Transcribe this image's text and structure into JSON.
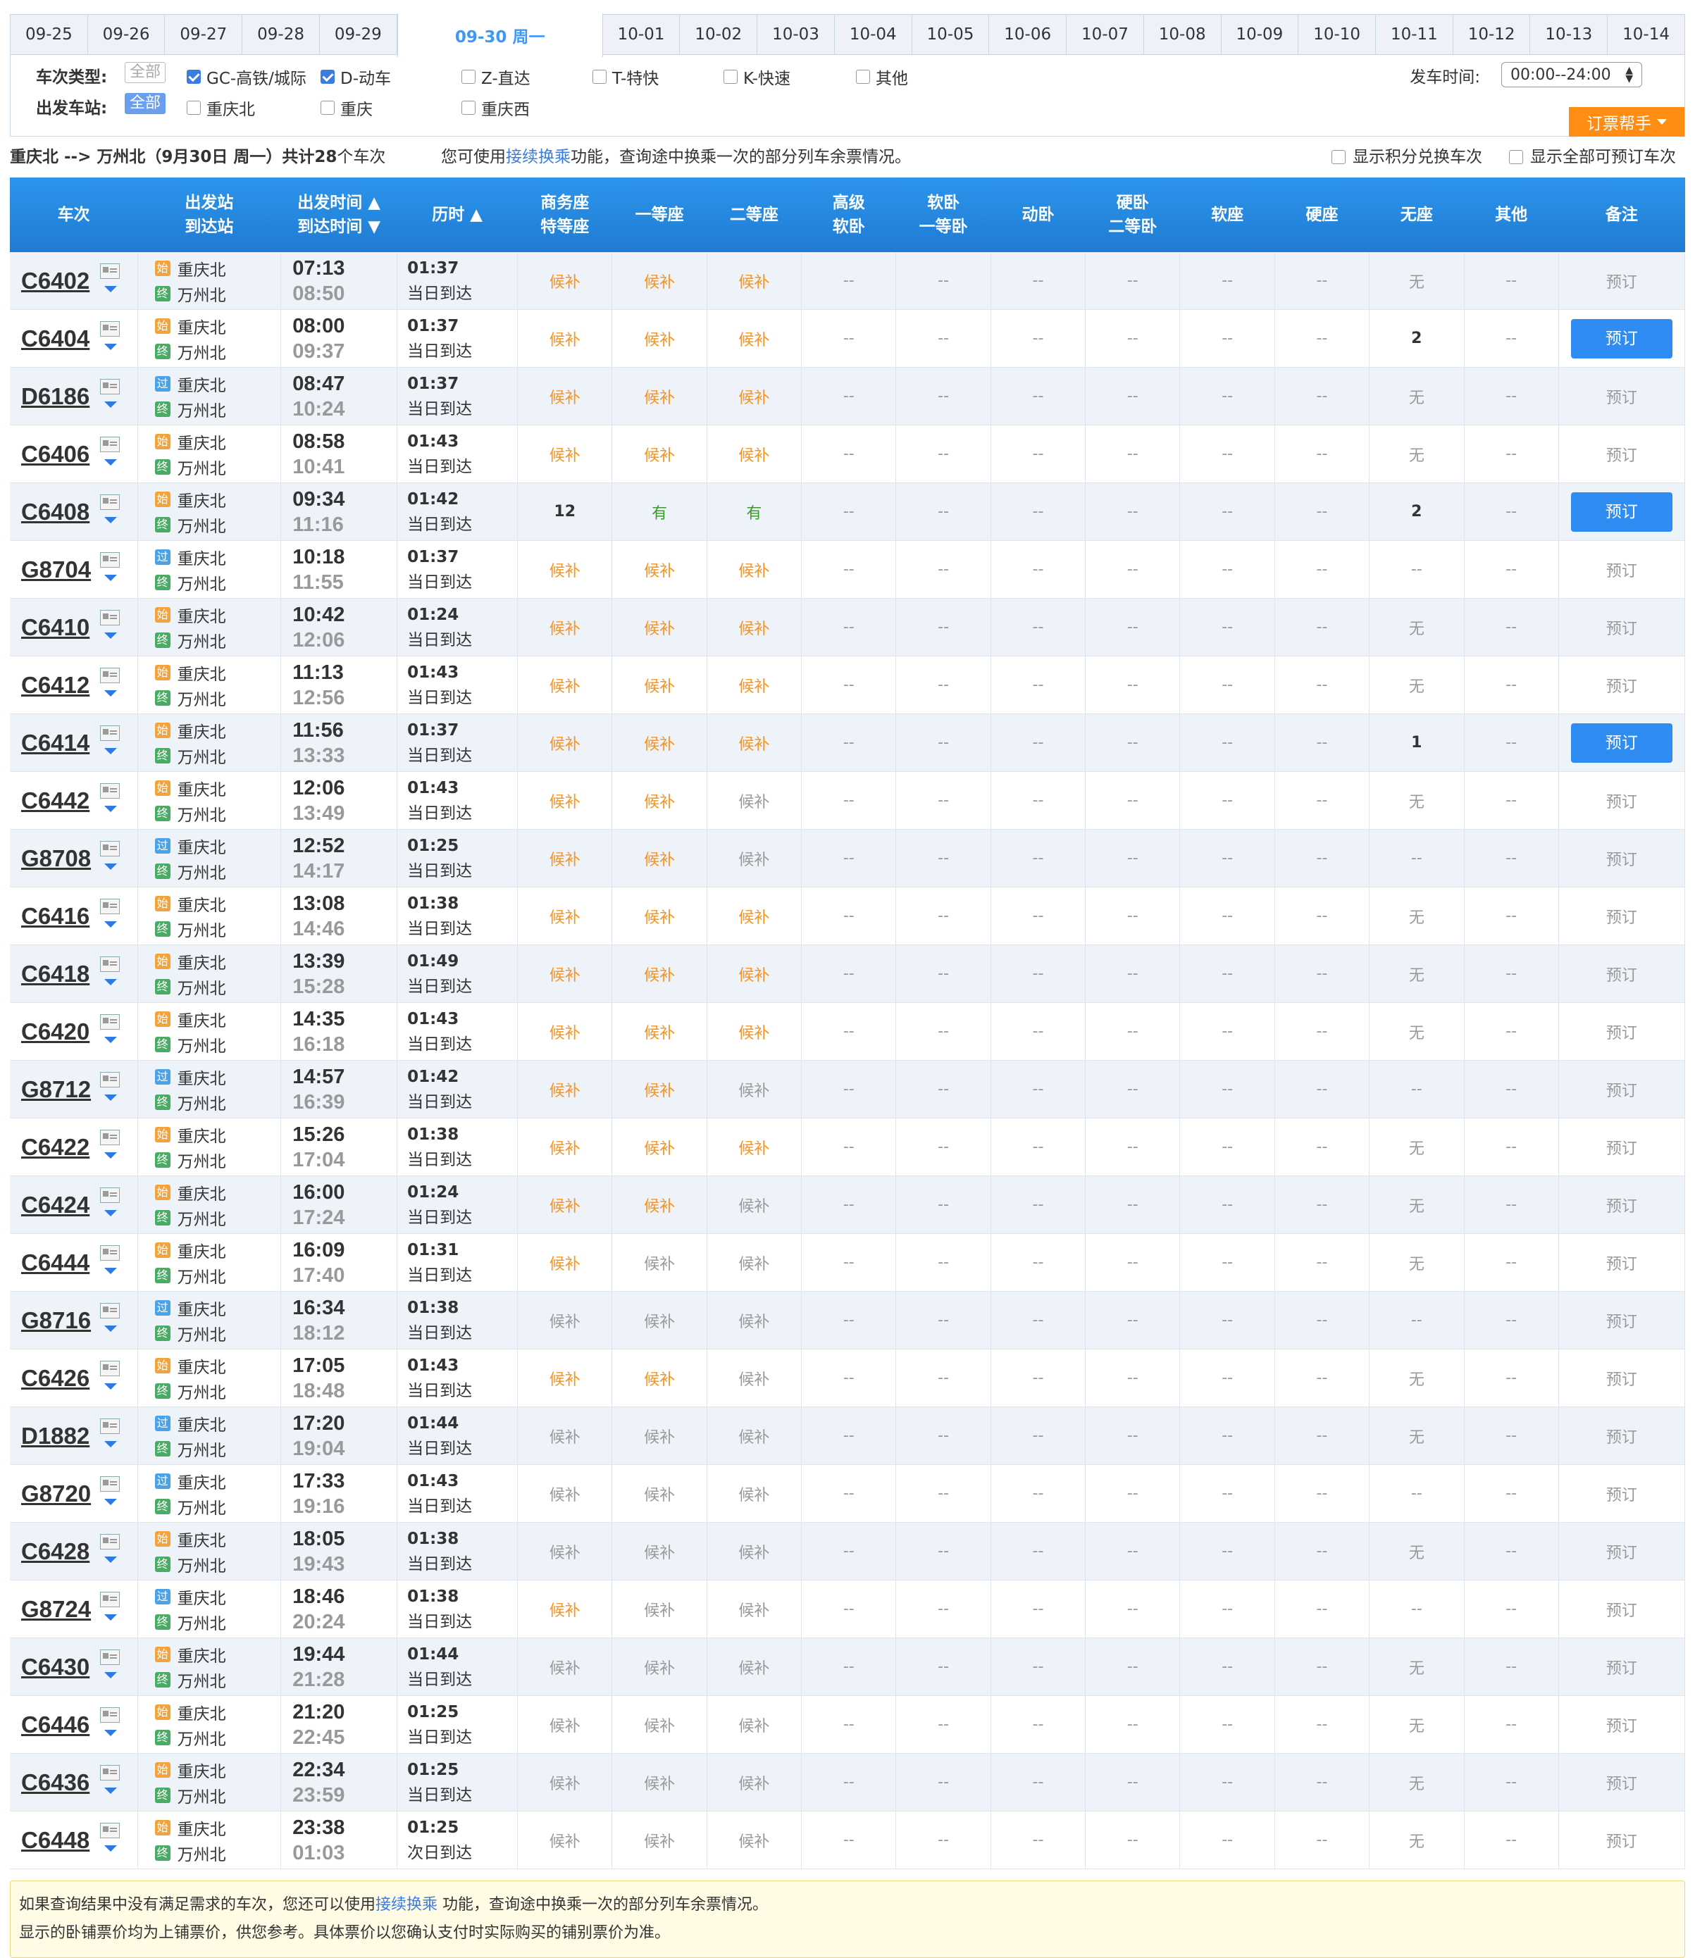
{
  "dates": [
    "09-25",
    "09-26",
    "09-27",
    "09-28",
    "09-29",
    "09-30 周一",
    "10-01",
    "10-02",
    "10-03",
    "10-04",
    "10-05",
    "10-06",
    "10-07",
    "10-08",
    "10-09",
    "10-10",
    "10-11",
    "10-12",
    "10-13",
    "10-14"
  ],
  "active_date": "09-30 周一",
  "filters": {
    "type_label": "车次类型:",
    "all": "全部",
    "types": [
      {
        "label": "GC-高铁/城际",
        "checked": true
      },
      {
        "label": "D-动车",
        "checked": true
      },
      {
        "label": "Z-直达",
        "checked": false
      },
      {
        "label": "T-特快",
        "checked": false
      },
      {
        "label": "K-快速",
        "checked": false
      },
      {
        "label": "其他",
        "checked": false
      }
    ],
    "station_label": "出发车站:",
    "stations": [
      {
        "label": "重庆北",
        "checked": false
      },
      {
        "label": "重庆",
        "checked": false
      },
      {
        "label": "重庆西",
        "checked": false
      }
    ],
    "time_label": "发车时间:",
    "time_value": "00:00--24:00",
    "helper": "订票帮手"
  },
  "info": {
    "route": "重庆北 --> 万州北（9月30日  周一）共计",
    "count": "28",
    "count_suffix": "个车次",
    "hint_pre": "您可使用",
    "hint_link": "接续换乘",
    "hint_post": "功能，查询途中换乘一次的部分列车余票情况。",
    "opt1": "显示积分兑换车次",
    "opt2": "显示全部可预订车次"
  },
  "headers": [
    "车次",
    "出发站|到达站",
    "出发时间 ▲|到达时间 ▼",
    "历时 ▲",
    "商务座|特等座",
    "一等座",
    "二等座",
    "高级|软卧",
    "软卧|一等卧",
    "动卧",
    "硬卧|二等卧",
    "软座",
    "硬座",
    "无座",
    "其他",
    "备注"
  ],
  "rows": [
    {
      "no": "C6402",
      "tag": "始",
      "from": "重庆北",
      "to": "万州北",
      "dep": "07:13",
      "arr": "08:50",
      "dur": "01:37",
      "day": "当日到达",
      "biz": "候补",
      "first": "候补",
      "second": "候补",
      "noseat": "无",
      "book": false
    },
    {
      "no": "C6404",
      "tag": "始",
      "from": "重庆北",
      "to": "万州北",
      "dep": "08:00",
      "arr": "09:37",
      "dur": "01:37",
      "day": "当日到达",
      "biz": "候补",
      "first": "候补",
      "second": "候补",
      "noseat": "2",
      "book": true
    },
    {
      "no": "D6186",
      "tag": "过",
      "from": "重庆北",
      "to": "万州北",
      "dep": "08:47",
      "arr": "10:24",
      "dur": "01:37",
      "day": "当日到达",
      "biz": "候补",
      "first": "候补",
      "second": "候补",
      "noseat": "无",
      "book": false
    },
    {
      "no": "C6406",
      "tag": "始",
      "from": "重庆北",
      "to": "万州北",
      "dep": "08:58",
      "arr": "10:41",
      "dur": "01:43",
      "day": "当日到达",
      "biz": "候补",
      "first": "候补",
      "second": "候补",
      "noseat": "无",
      "book": false
    },
    {
      "no": "C6408",
      "tag": "始",
      "from": "重庆北",
      "to": "万州北",
      "dep": "09:34",
      "arr": "11:16",
      "dur": "01:42",
      "day": "当日到达",
      "biz": "12",
      "first": "有",
      "second": "有",
      "noseat": "2",
      "book": true
    },
    {
      "no": "G8704",
      "tag": "过",
      "from": "重庆北",
      "to": "万州北",
      "dep": "10:18",
      "arr": "11:55",
      "dur": "01:37",
      "day": "当日到达",
      "biz": "候补",
      "first": "候补",
      "second": "候补",
      "noseat": "--",
      "book": false
    },
    {
      "no": "C6410",
      "tag": "始",
      "from": "重庆北",
      "to": "万州北",
      "dep": "10:42",
      "arr": "12:06",
      "dur": "01:24",
      "day": "当日到达",
      "biz": "候补",
      "first": "候补",
      "second": "候补",
      "noseat": "无",
      "book": false
    },
    {
      "no": "C6412",
      "tag": "始",
      "from": "重庆北",
      "to": "万州北",
      "dep": "11:13",
      "arr": "12:56",
      "dur": "01:43",
      "day": "当日到达",
      "biz": "候补",
      "first": "候补",
      "second": "候补",
      "noseat": "无",
      "book": false
    },
    {
      "no": "C6414",
      "tag": "始",
      "from": "重庆北",
      "to": "万州北",
      "dep": "11:56",
      "arr": "13:33",
      "dur": "01:37",
      "day": "当日到达",
      "biz": "候补",
      "first": "候补",
      "second": "候补",
      "noseat": "1",
      "book": true
    },
    {
      "no": "C6442",
      "tag": "始",
      "from": "重庆北",
      "to": "万州北",
      "dep": "12:06",
      "arr": "13:49",
      "dur": "01:43",
      "day": "当日到达",
      "biz": "候补",
      "first": "候补",
      "second": "候补g",
      "noseat": "无",
      "book": false
    },
    {
      "no": "G8708",
      "tag": "过",
      "from": "重庆北",
      "to": "万州北",
      "dep": "12:52",
      "arr": "14:17",
      "dur": "01:25",
      "day": "当日到达",
      "biz": "候补",
      "first": "候补",
      "second": "候补g",
      "noseat": "--",
      "book": false
    },
    {
      "no": "C6416",
      "tag": "始",
      "from": "重庆北",
      "to": "万州北",
      "dep": "13:08",
      "arr": "14:46",
      "dur": "01:38",
      "day": "当日到达",
      "biz": "候补",
      "first": "候补",
      "second": "候补",
      "noseat": "无",
      "book": false
    },
    {
      "no": "C6418",
      "tag": "始",
      "from": "重庆北",
      "to": "万州北",
      "dep": "13:39",
      "arr": "15:28",
      "dur": "01:49",
      "day": "当日到达",
      "biz": "候补",
      "first": "候补",
      "second": "候补",
      "noseat": "无",
      "book": false
    },
    {
      "no": "C6420",
      "tag": "始",
      "from": "重庆北",
      "to": "万州北",
      "dep": "14:35",
      "arr": "16:18",
      "dur": "01:43",
      "day": "当日到达",
      "biz": "候补",
      "first": "候补",
      "second": "候补",
      "noseat": "无",
      "book": false
    },
    {
      "no": "G8712",
      "tag": "过",
      "from": "重庆北",
      "to": "万州北",
      "dep": "14:57",
      "arr": "16:39",
      "dur": "01:42",
      "day": "当日到达",
      "biz": "候补",
      "first": "候补",
      "second": "候补g",
      "noseat": "--",
      "book": false
    },
    {
      "no": "C6422",
      "tag": "始",
      "from": "重庆北",
      "to": "万州北",
      "dep": "15:26",
      "arr": "17:04",
      "dur": "01:38",
      "day": "当日到达",
      "biz": "候补",
      "first": "候补",
      "second": "候补",
      "noseat": "无",
      "book": false
    },
    {
      "no": "C6424",
      "tag": "始",
      "from": "重庆北",
      "to": "万州北",
      "dep": "16:00",
      "arr": "17:24",
      "dur": "01:24",
      "day": "当日到达",
      "biz": "候补",
      "first": "候补",
      "second": "候补g",
      "noseat": "无",
      "book": false
    },
    {
      "no": "C6444",
      "tag": "始",
      "from": "重庆北",
      "to": "万州北",
      "dep": "16:09",
      "arr": "17:40",
      "dur": "01:31",
      "day": "当日到达",
      "biz": "候补",
      "first": "候补g",
      "second": "候补g",
      "noseat": "无",
      "book": false
    },
    {
      "no": "G8716",
      "tag": "过",
      "from": "重庆北",
      "to": "万州北",
      "dep": "16:34",
      "arr": "18:12",
      "dur": "01:38",
      "day": "当日到达",
      "biz": "候补g",
      "first": "候补g",
      "second": "候补g",
      "noseat": "--",
      "book": false
    },
    {
      "no": "C6426",
      "tag": "始",
      "from": "重庆北",
      "to": "万州北",
      "dep": "17:05",
      "arr": "18:48",
      "dur": "01:43",
      "day": "当日到达",
      "biz": "候补",
      "first": "候补",
      "second": "候补g",
      "noseat": "无",
      "book": false
    },
    {
      "no": "D1882",
      "tag": "过",
      "from": "重庆北",
      "to": "万州北",
      "dep": "17:20",
      "arr": "19:04",
      "dur": "01:44",
      "day": "当日到达",
      "biz": "候补g",
      "first": "候补g",
      "second": "候补g",
      "noseat": "无",
      "book": false
    },
    {
      "no": "G8720",
      "tag": "过",
      "from": "重庆北",
      "to": "万州北",
      "dep": "17:33",
      "arr": "19:16",
      "dur": "01:43",
      "day": "当日到达",
      "biz": "候补g",
      "first": "候补g",
      "second": "候补g",
      "noseat": "--",
      "book": false
    },
    {
      "no": "C6428",
      "tag": "始",
      "from": "重庆北",
      "to": "万州北",
      "dep": "18:05",
      "arr": "19:43",
      "dur": "01:38",
      "day": "当日到达",
      "biz": "候补g",
      "first": "候补g",
      "second": "候补g",
      "noseat": "无",
      "book": false
    },
    {
      "no": "G8724",
      "tag": "过",
      "from": "重庆北",
      "to": "万州北",
      "dep": "18:46",
      "arr": "20:24",
      "dur": "01:38",
      "day": "当日到达",
      "biz": "候补",
      "first": "候补g",
      "second": "候补g",
      "noseat": "--",
      "book": false
    },
    {
      "no": "C6430",
      "tag": "始",
      "from": "重庆北",
      "to": "万州北",
      "dep": "19:44",
      "arr": "21:28",
      "dur": "01:44",
      "day": "当日到达",
      "biz": "候补g",
      "first": "候补g",
      "second": "候补g",
      "noseat": "无",
      "book": false
    },
    {
      "no": "C6446",
      "tag": "始",
      "from": "重庆北",
      "to": "万州北",
      "dep": "21:20",
      "arr": "22:45",
      "dur": "01:25",
      "day": "当日到达",
      "biz": "候补g",
      "first": "候补g",
      "second": "候补g",
      "noseat": "无",
      "book": false
    },
    {
      "no": "C6436",
      "tag": "始",
      "from": "重庆北",
      "to": "万州北",
      "dep": "22:34",
      "arr": "23:59",
      "dur": "01:25",
      "day": "当日到达",
      "biz": "候补g",
      "first": "候补g",
      "second": "候补g",
      "noseat": "无",
      "book": false
    },
    {
      "no": "C6448",
      "tag": "始",
      "from": "重庆北",
      "to": "万州北",
      "dep": "23:38",
      "arr": "01:03",
      "dur": "01:25",
      "day": "次日到达",
      "biz": "候补g",
      "first": "候补g",
      "second": "候补g",
      "noseat": "无",
      "book": false
    }
  ],
  "labels": {
    "end_tag": "终",
    "dash": "--",
    "book": "预订"
  },
  "note": {
    "line1_pre": "如果查询结果中没有满足需求的车次，您还可以使用",
    "line1_link": "接续换乘",
    "line1_post": " 功能，查询途中换乘一次的部分列车余票情况。",
    "line2": "显示的卧铺票价均为上铺票价，供您参考。具体票价以您确认支付时实际购买的铺别票价为准。"
  },
  "colors": {
    "accent": "#2f8cf2",
    "orange": "#f7931e",
    "header": "#1f7bd2"
  }
}
